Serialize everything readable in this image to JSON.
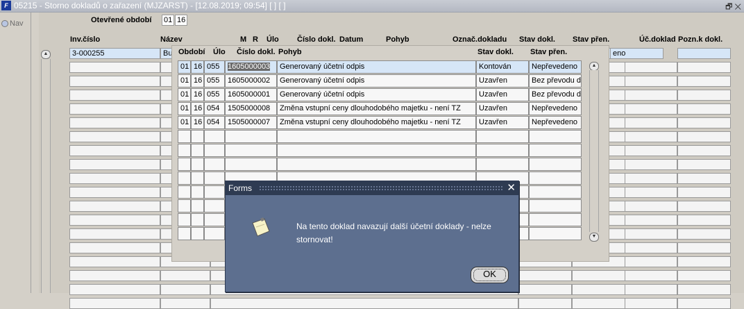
{
  "window": {
    "title": "05215 - Storno dokladů o zařazení (MJZARST) - [12.08.2019; 09:54]  [ ]  [ ]",
    "app_icon": "forms-icon",
    "restore_icon": "restore-window-icon"
  },
  "nav": {
    "label": "Nav"
  },
  "period": {
    "label": "Otevřené období",
    "field1": "01",
    "field2": "16"
  },
  "grid": {
    "headers": {
      "inv_cislo": "Inv.číslo",
      "nazev": "Název",
      "m": "M",
      "r": "R",
      "ulo": "Úlo",
      "cislo_dokl": "Číslo dokl.",
      "datum": "Datum",
      "pohyb": "Pohyb",
      "oznac_dokladu": "Označ.dokladu",
      "stav_dokl": "Stav dokl.",
      "stav_pren": "Stav přen.",
      "uc_doklad": "Úč.doklad",
      "pozn_k_dokl": "Pozn.k dokl."
    },
    "first_row": {
      "inv_cislo": "3-000255",
      "nazev": "Bu",
      "stav_pren": "eno"
    }
  },
  "popup_list": {
    "headers": {
      "obdobi": "Období",
      "ulo": "Úlo",
      "cislo_dokl": "Číslo dokl.",
      "pohyb": "Pohyb",
      "stav_dokl": "Stav dokl.",
      "stav_pren": "Stav přen."
    },
    "rows": [
      {
        "o1": "01",
        "o2": "16",
        "ulo": "055",
        "cislo": "1605000003",
        "pohyb": "Generovaný účetní odpis",
        "stav_dokl": "Kontován",
        "stav_pren": "Nepřevedeno"
      },
      {
        "o1": "01",
        "o2": "16",
        "ulo": "055",
        "cislo": "1605000002",
        "pohyb": "Generovaný účetní odpis",
        "stav_dokl": "Uzavřen",
        "stav_pren": "Bez převodu d"
      },
      {
        "o1": "01",
        "o2": "16",
        "ulo": "055",
        "cislo": "1605000001",
        "pohyb": "Generovaný účetní odpis",
        "stav_dokl": "Uzavřen",
        "stav_pren": "Bez převodu d"
      },
      {
        "o1": "01",
        "o2": "16",
        "ulo": "054",
        "cislo": "1505000008",
        "pohyb": "Změna vstupní ceny dlouhodobého majetku - není TZ",
        "stav_dokl": "Uzavřen",
        "stav_pren": "Nepřevedeno"
      },
      {
        "o1": "01",
        "o2": "16",
        "ulo": "054",
        "cislo": "1505000007",
        "pohyb": "Změna vstupní ceny dlouhodobého majetku - není TZ",
        "stav_dokl": "Uzavřen",
        "stav_pren": "Nepřevedeno"
      }
    ]
  },
  "dialog": {
    "title": "Forms",
    "message": "Na tento doklad navazují další účetní doklady - nelze stornovat!",
    "ok_label": "OK",
    "icon": "note-icon"
  }
}
